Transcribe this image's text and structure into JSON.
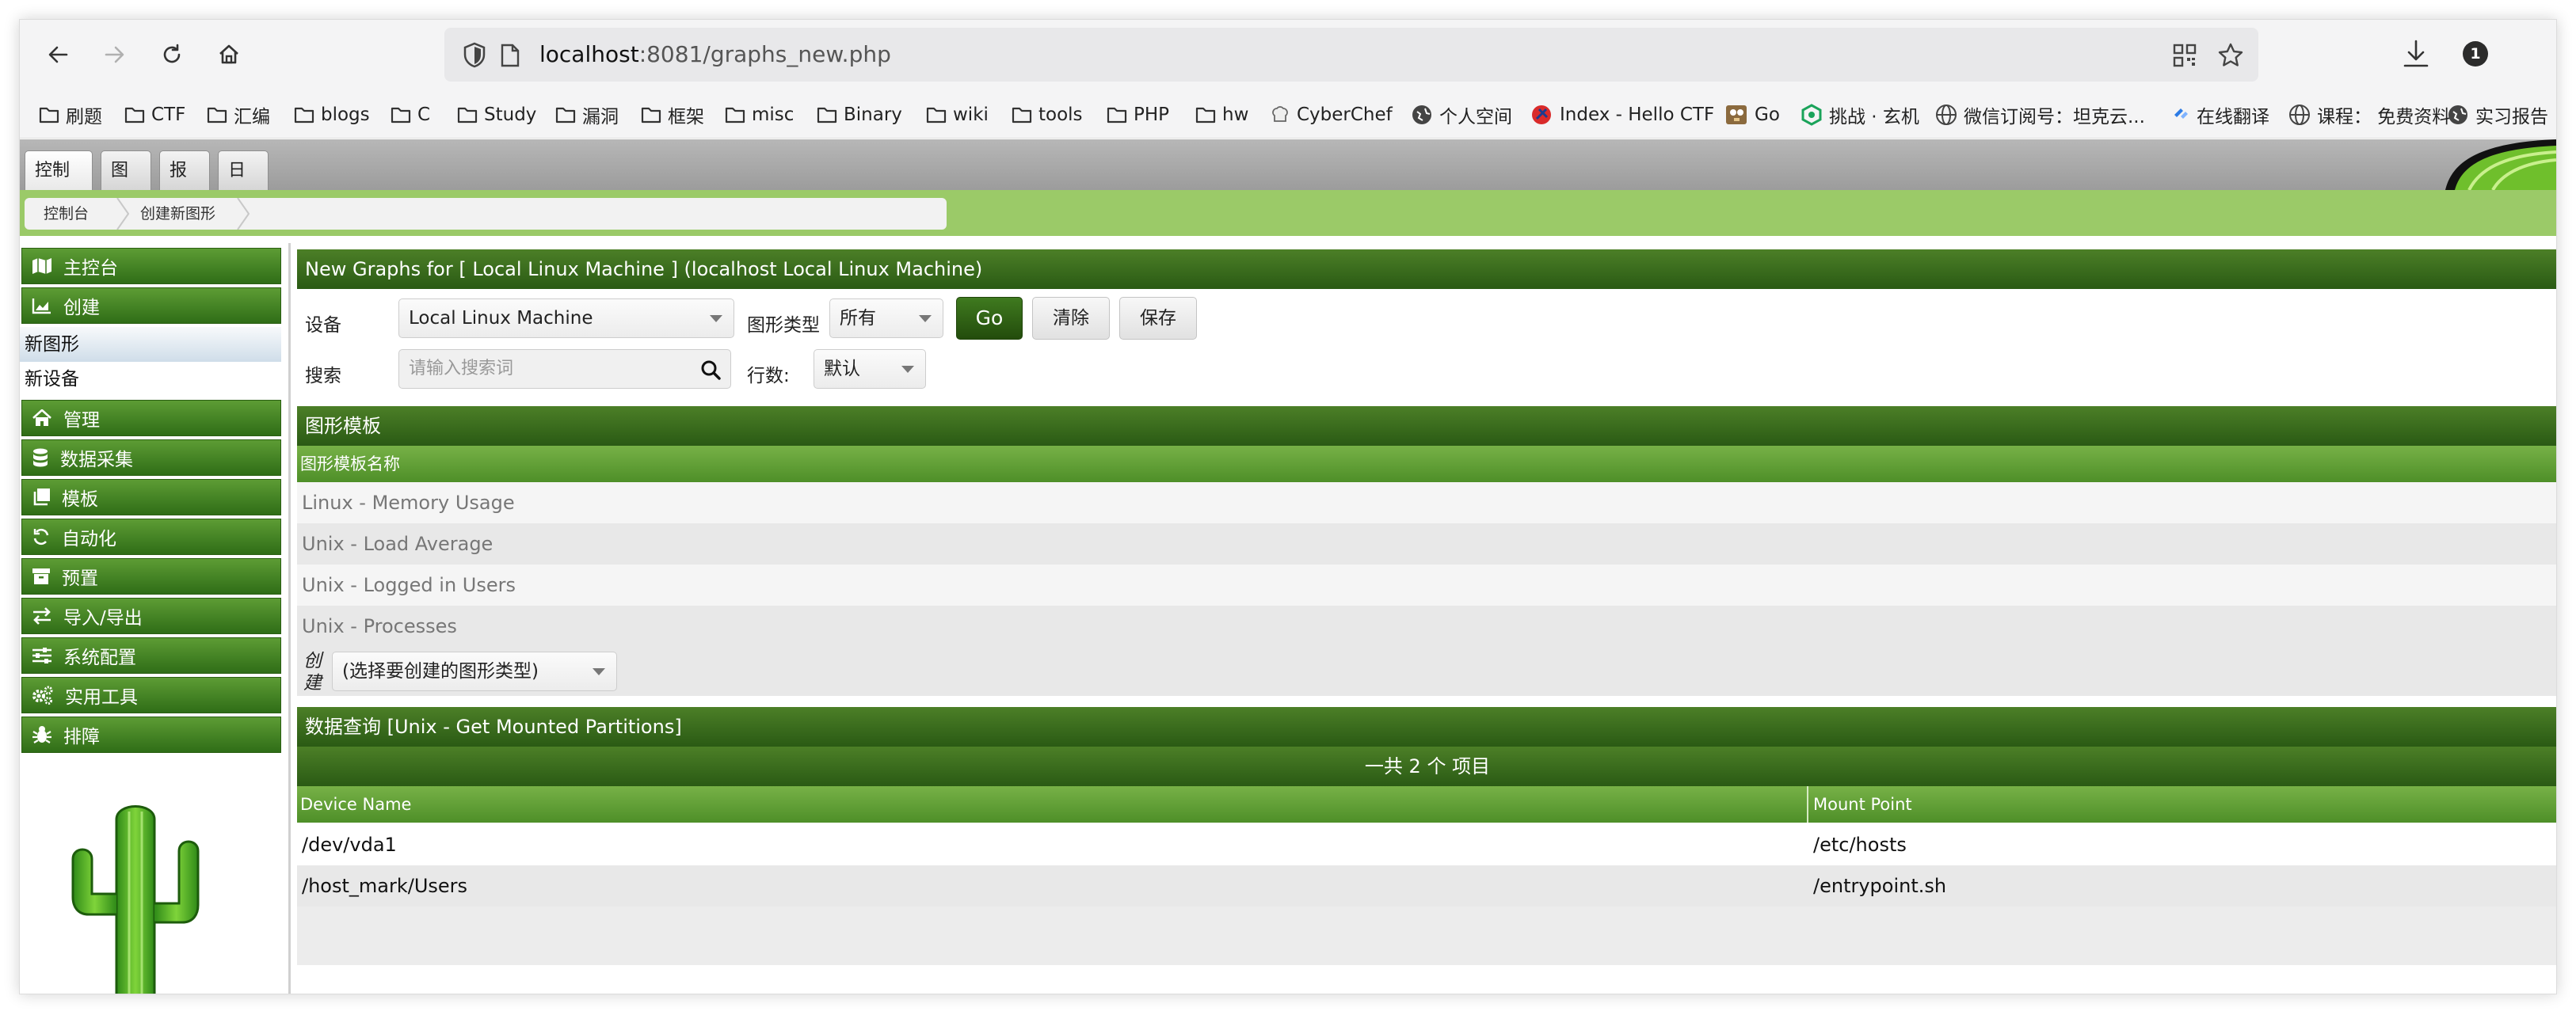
{
  "browser": {
    "url_host": "localhost",
    "url_rest": ":8081/graphs_new.php",
    "badge_count": "1"
  },
  "bookmarks": [
    "刷题",
    "CTF",
    "汇编",
    "blogs",
    "C",
    "Study",
    "漏洞",
    "框架",
    "misc",
    "Binary",
    "wiki",
    "tools",
    "PHP",
    "hw",
    "CyberChef",
    "个人空间",
    "Index - Hello CTF",
    "Go",
    "挑战 · 玄机",
    "微信订阅号：坦克云...",
    "在线翻译",
    "课程： 免费资料",
    "实习报告"
  ],
  "tabs": [
    "控制台",
    "图形",
    "报告",
    "日志"
  ],
  "breadcrumb": [
    "控制台",
    "创建新图形"
  ],
  "menu": {
    "console": "主控台",
    "create": "创建",
    "new_graphs": "新图形",
    "new_device": "新设备",
    "management": "管理",
    "data_collection": "数据采集",
    "templates": "模板",
    "automation": "自动化",
    "presets": "预置",
    "import_export": "导入/导出",
    "configuration": "系统配置",
    "utilities": "实用工具",
    "troubleshooting": "排障"
  },
  "main": {
    "title": "New Graphs for [ Local Linux Machine ] (localhost Local Linux Machine)",
    "device_label": "设备",
    "device_value": "Local Linux Machine",
    "graph_type_label": "图形类型",
    "graph_type_value": "所有",
    "go_label": "Go",
    "clear_label": "清除",
    "save_label": "保存",
    "search_label": "搜索",
    "search_placeholder": "请输入搜索词",
    "rows_label": "行数:",
    "rows_value": "默认"
  },
  "graph_templates": {
    "header": "图形模板",
    "column": "图形模板名称",
    "items": [
      "Linux - Memory Usage",
      "Unix - Load Average",
      "Unix - Logged in Users",
      "Unix - Processes"
    ],
    "create_label": "创建",
    "create_select": "(选择要创建的图形类型)"
  },
  "data_query": {
    "header": "数据查询 [Unix - Get Mounted Partitions]",
    "summary": "一共 2 个 项目",
    "columns": [
      "Device Name",
      "Mount Point"
    ],
    "rows": [
      [
        "/dev/vda1",
        "/etc/hosts"
      ],
      [
        "/host_mark/Users",
        "/entrypoint.sh"
      ]
    ]
  }
}
